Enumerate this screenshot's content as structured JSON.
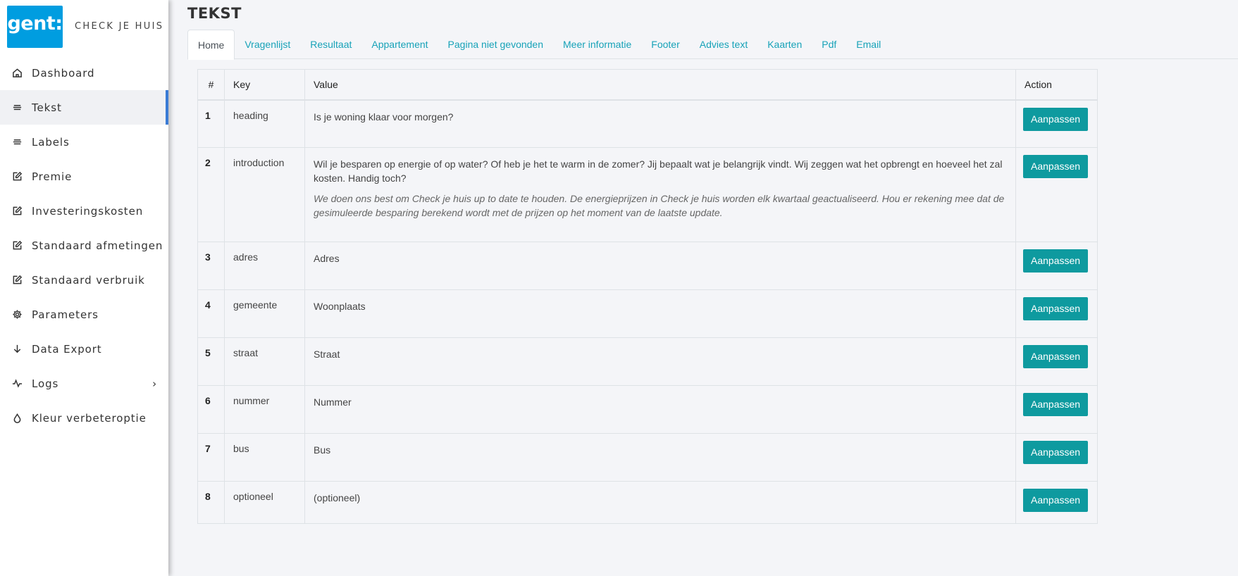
{
  "brand": {
    "logo_text": "gent:",
    "app_name": "CHECK JE HUIS"
  },
  "sidebar": {
    "items": [
      {
        "label": "Dashboard",
        "icon": "home-icon"
      },
      {
        "label": "Tekst",
        "icon": "text-lines-icon"
      },
      {
        "label": "Labels",
        "icon": "text-lines-icon"
      },
      {
        "label": "Premie",
        "icon": "edit-icon"
      },
      {
        "label": "Investeringskosten",
        "icon": "edit-icon"
      },
      {
        "label": "Standaard afmetingen",
        "icon": "edit-icon"
      },
      {
        "label": "Standaard verbruik",
        "icon": "edit-icon"
      },
      {
        "label": "Parameters",
        "icon": "gear-icon"
      },
      {
        "label": "Data Export",
        "icon": "arrow-down-icon"
      },
      {
        "label": "Logs",
        "icon": "activity-icon"
      },
      {
        "label": "Kleur verbeteroptie",
        "icon": "droplet-icon"
      }
    ],
    "active_index": 1
  },
  "page": {
    "title": "TEKST"
  },
  "tabs": [
    "Home",
    "Vragenlijst",
    "Resultaat",
    "Appartement",
    "Pagina niet gevonden",
    "Meer informatie",
    "Footer",
    "Advies text",
    "Kaarten",
    "Pdf",
    "Email"
  ],
  "active_tab": "Home",
  "table": {
    "headers": {
      "num": "#",
      "key": "Key",
      "value": "Value",
      "action": "Action"
    },
    "action_label": "Aanpassen",
    "rows": [
      {
        "num": "1",
        "key": "heading",
        "value": "Is je woning klaar voor morgen?"
      },
      {
        "num": "2",
        "key": "introduction",
        "value": "Wil je besparen op energie of op water? Of heb je het te warm in de zomer? Jij bepaalt wat je belangrijk vindt. Wij zeggen wat het opbrengt en hoeveel het zal kosten. Handig toch?",
        "value_italic": "We doen ons best om Check je huis up to date te houden. De energieprijzen in Check je huis worden elk kwartaal geactualiseerd. Hou er rekening mee dat de gesimuleerde besparing berekend wordt met de prijzen op het moment van de laatste update."
      },
      {
        "num": "3",
        "key": "adres",
        "value": "Adres"
      },
      {
        "num": "4",
        "key": "gemeente",
        "value": "Woonplaats"
      },
      {
        "num": "5",
        "key": "straat",
        "value": "Straat"
      },
      {
        "num": "6",
        "key": "nummer",
        "value": "Nummer"
      },
      {
        "num": "7",
        "key": "bus",
        "value": "Bus"
      },
      {
        "num": "8",
        "key": "optioneel",
        "value": "(optioneel)"
      }
    ]
  },
  "colors": {
    "accent": "#0e9a9f",
    "tab_link": "#17a2b8",
    "logo_bg": "#009de0",
    "active_bar": "#3a7bd5"
  }
}
